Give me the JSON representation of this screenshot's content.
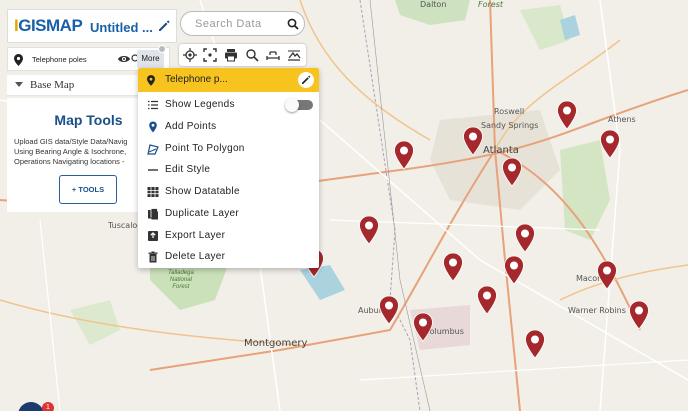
{
  "app": {
    "logo_text": "IGISMAP",
    "map_title": "Untitled ..."
  },
  "layer": {
    "name": "Telephone poles",
    "more_label": "More"
  },
  "base_map": {
    "label": "Base Map"
  },
  "map_tools": {
    "title": "Map Tools",
    "description_lines": [
      "Upload GIS data/Style Data/Navig",
      "Using Bearing Angle & Isochrone,",
      "Operations Navigating locations -"
    ],
    "add_tools_label": "+ TOOLS"
  },
  "search": {
    "placeholder": "Search Data"
  },
  "toolbar": {
    "icons": [
      "locate-icon",
      "fullscreen-icon",
      "print-icon",
      "zoom-search-icon",
      "measure-icon",
      "terrain-icon"
    ]
  },
  "menu": {
    "header_label": "Telephone p...",
    "items": [
      {
        "label": "Show Legends",
        "icon": "legend-list-icon"
      },
      {
        "label": "Add Points",
        "icon": "map-pin-icon"
      },
      {
        "label": "Point To Polygon",
        "icon": "polygon-icon"
      },
      {
        "label": "Edit Style",
        "icon": "style-line-icon"
      },
      {
        "label": "Show Datatable",
        "icon": "table-icon"
      },
      {
        "label": "Duplicate Layer",
        "icon": "duplicate-icon"
      },
      {
        "label": "Export Layer",
        "icon": "export-icon"
      },
      {
        "label": "Delete Layer",
        "icon": "trash-icon"
      }
    ],
    "show_legends_on": false
  },
  "map_labels": {
    "atlanta": "Atlanta",
    "montgomery": "Montgomery",
    "auburn": "Auburn",
    "columbus": "Columbus",
    "macon": "Macon",
    "roswell": "Roswell",
    "sandy_springs": "Sandy Springs",
    "athens": "Athens",
    "warner_robins": "Warner Robins",
    "tuscaloosa": "Tuscaloo",
    "dalton": "Dalton",
    "forest_top": "Forest",
    "talladega": "Talladega\nNational\nForest"
  },
  "notification_count": "1",
  "colors": {
    "marker": "#a4282c",
    "menu_header": "#f7c41f",
    "brand": "#1a5fa8"
  }
}
